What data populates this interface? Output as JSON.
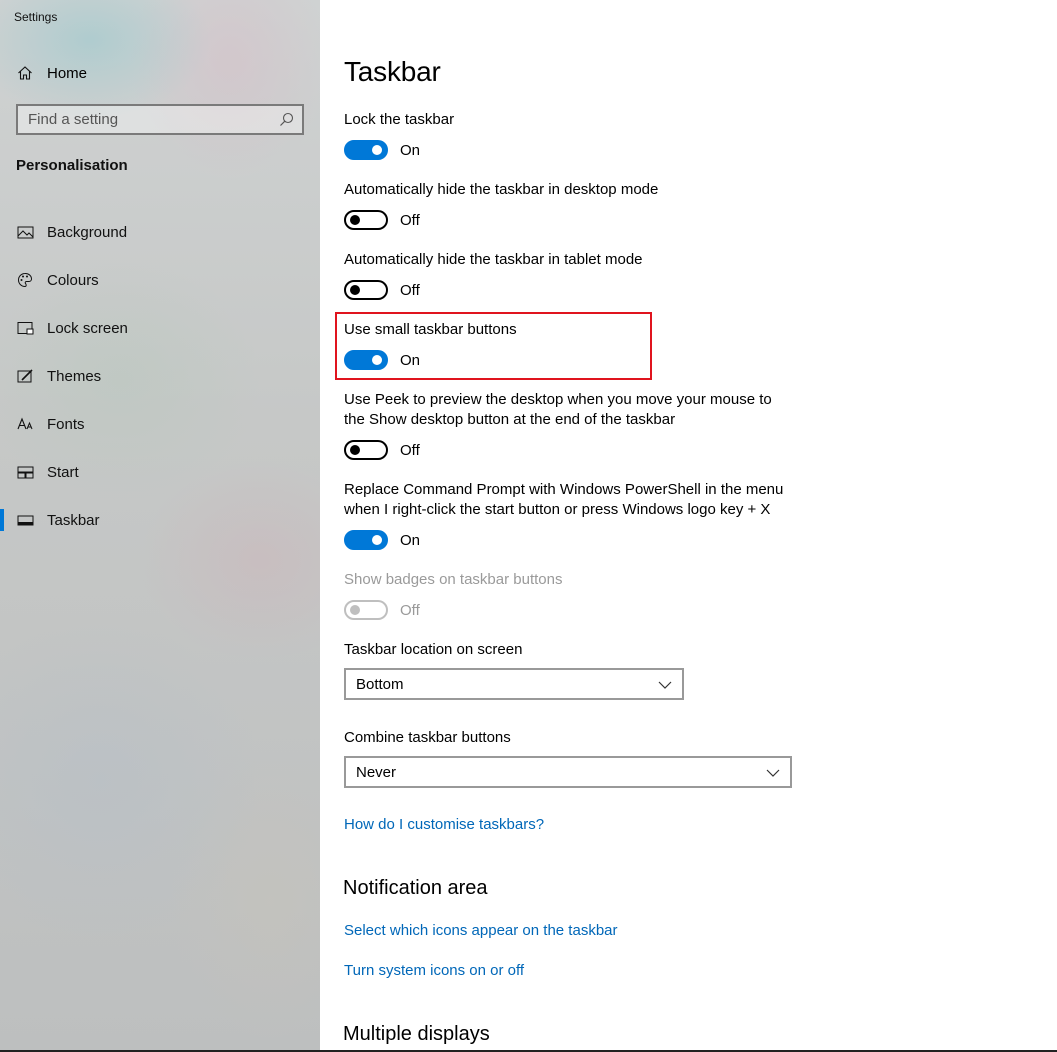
{
  "app_title": "Settings",
  "sidebar": {
    "home_label": "Home",
    "search_placeholder": "Find a setting",
    "section_title": "Personalisation",
    "items": [
      {
        "label": "Background",
        "icon": "picture-icon"
      },
      {
        "label": "Colours",
        "icon": "palette-icon"
      },
      {
        "label": "Lock screen",
        "icon": "lock-screen-icon"
      },
      {
        "label": "Themes",
        "icon": "brush-icon"
      },
      {
        "label": "Fonts",
        "icon": "font-icon"
      },
      {
        "label": "Start",
        "icon": "start-tiles-icon"
      },
      {
        "label": "Taskbar",
        "icon": "taskbar-icon",
        "active": true
      }
    ]
  },
  "main": {
    "title": "Taskbar",
    "settings": [
      {
        "label": "Lock the taskbar",
        "state": "On"
      },
      {
        "label": "Automatically hide the taskbar in desktop mode",
        "state": "Off"
      },
      {
        "label": "Automatically hide the taskbar in tablet mode",
        "state": "Off"
      },
      {
        "label": "Use small taskbar buttons",
        "state": "On"
      },
      {
        "label_line1": "Use Peek to preview the desktop when you move your mouse to",
        "label_line2": "the Show desktop button at the end of the taskbar",
        "state": "Off"
      },
      {
        "label_line1": "Replace Command Prompt with Windows PowerShell in the menu",
        "label_line2": "when I right-click the start button or press Windows logo key + X",
        "state": "On"
      },
      {
        "label": "Show badges on taskbar buttons",
        "state": "Off",
        "disabled": true
      }
    ],
    "location": {
      "label": "Taskbar location on screen",
      "value": "Bottom"
    },
    "combine": {
      "label": "Combine taskbar buttons",
      "value": "Never"
    },
    "help_link": "How do I customise taskbars?",
    "notification_area": {
      "heading": "Notification area",
      "link1": "Select which icons appear on the taskbar",
      "link2": "Turn system icons on or off"
    },
    "multiple_displays": {
      "heading": "Multiple displays"
    }
  },
  "colors": {
    "accent": "#0078d7",
    "link": "#0067b8",
    "highlight": "#e0141e"
  }
}
